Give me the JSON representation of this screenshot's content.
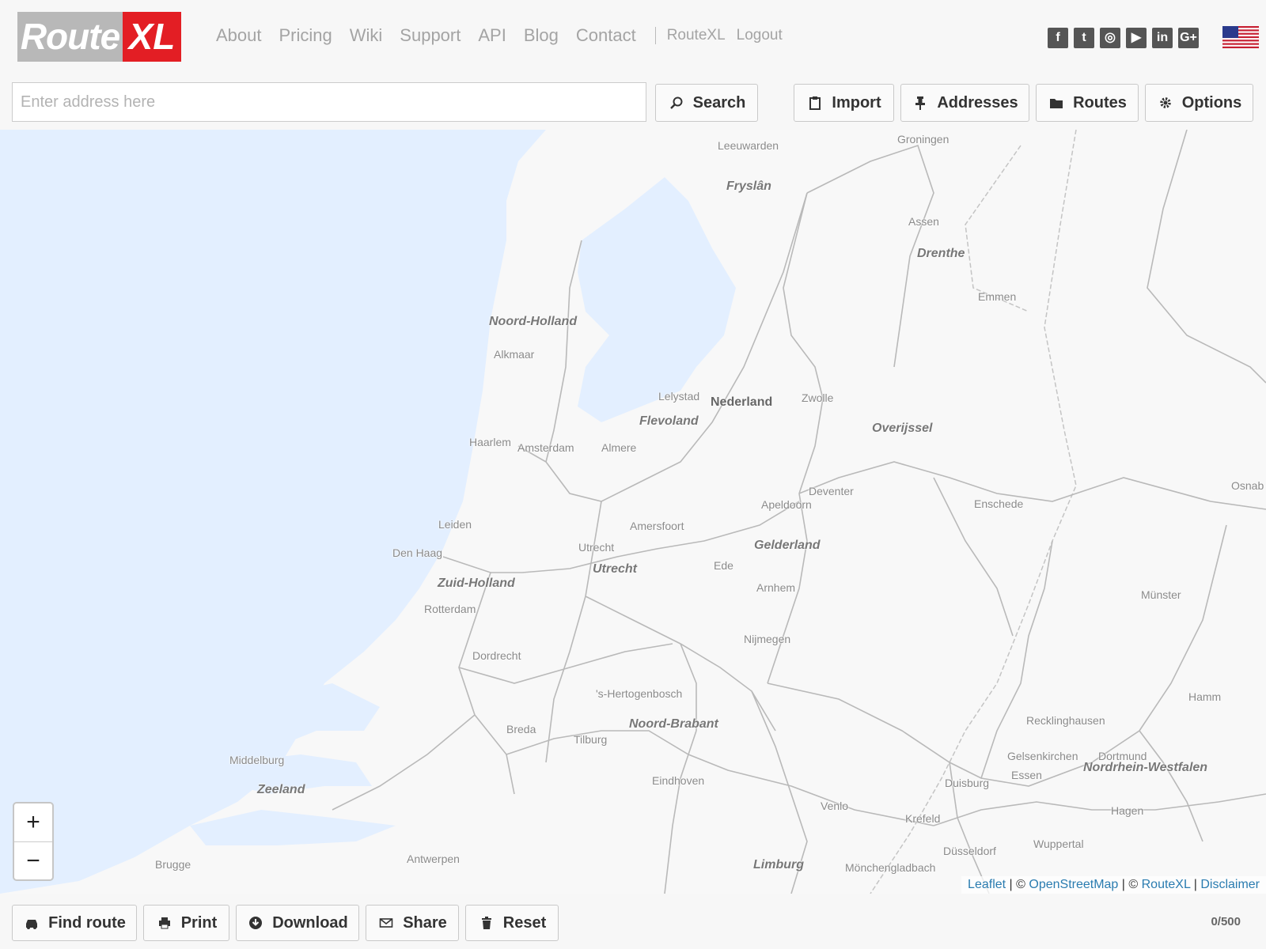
{
  "header": {
    "logo": {
      "part1": "Route",
      "part2": "XL"
    },
    "nav": [
      "About",
      "Pricing",
      "Wiki",
      "Support",
      "API",
      "Blog",
      "Contact"
    ],
    "account": {
      "user": "RouteXL",
      "logout": "Logout"
    },
    "social": [
      {
        "icon": "facebook-icon",
        "glyph": "f"
      },
      {
        "icon": "twitter-icon",
        "glyph": "t"
      },
      {
        "icon": "instagram-icon",
        "glyph": "◎"
      },
      {
        "icon": "youtube-icon",
        "glyph": "▶"
      },
      {
        "icon": "linkedin-icon",
        "glyph": "in"
      },
      {
        "icon": "google-plus-icon",
        "glyph": "G+"
      }
    ],
    "language_flag": "us-flag-icon"
  },
  "toolbar": {
    "address_placeholder": "Enter address here",
    "address_value": "",
    "search_label": "Search",
    "import_label": "Import",
    "addresses_label": "Addresses",
    "routes_label": "Routes",
    "options_label": "Options"
  },
  "map": {
    "places": [
      "Leeuwarden",
      "Groningen",
      "Assen",
      "Emmen",
      "Alkmaar",
      "Lelystad",
      "Zwolle",
      "Haarlem",
      "Amsterdam",
      "Almere",
      "Deventer",
      "Apeldoorn",
      "Enschede",
      "Osnab",
      "Leiden",
      "Amersfoort",
      "Den Haag",
      "Utrecht",
      "Ede",
      "Arnhem",
      "Münster",
      "Rotterdam",
      "Nijmegen",
      "Dordrecht",
      "'s-Hertogenbosch",
      "Hamm",
      "Breda",
      "Tilburg",
      "Recklinghausen",
      "Middelburg",
      "Gelsenkirchen",
      "Dortmund",
      "Essen",
      "Eindhoven",
      "Duisburg",
      "Hagen",
      "Venlo",
      "Krefeld",
      "Wuppertal",
      "Antwerpen",
      "Brugge",
      "Düsseldorf",
      "Mönchengladbach"
    ],
    "regions": [
      "Fryslân",
      "Drenthe",
      "Noord-Holland",
      "Flevoland",
      "Overijssel",
      "Gelderland",
      "Utrecht",
      "Zuid-Holland",
      "Noord-Brabant",
      "Zeeland",
      "Nordrhein-Westfalen",
      "Limburg"
    ],
    "country": "Nederland",
    "zoom_in": "+",
    "zoom_out": "−",
    "attribution": {
      "leaflet": "Leaflet",
      "sep1": " | © ",
      "osm": "OpenStreetMap",
      "sep2": " | © ",
      "routexl": "RouteXL",
      "sep3": " | ",
      "disclaimer": "Disclaimer"
    },
    "colors": {
      "water": "#e3efff",
      "land": "#f8f8f8",
      "road": "#b9b9b9",
      "border": "#c4c4c4"
    }
  },
  "bottombar": {
    "find_route": "Find route",
    "print": "Print",
    "download": "Download",
    "share": "Share",
    "reset": "Reset",
    "counter": "0/500"
  },
  "colors": {
    "brand_red": "#e31e24",
    "logo_grey": "#b8b8b8",
    "link_blue": "#2a7cb0"
  }
}
